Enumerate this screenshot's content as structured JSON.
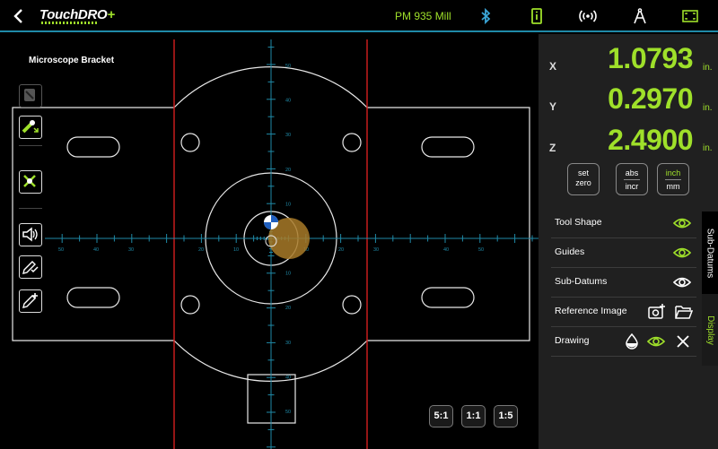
{
  "app": {
    "logo_main": "TouchDRO",
    "logo_plus": "+",
    "machine_name": "PM 935 Mill"
  },
  "drawing": {
    "title": "Microscope Bracket",
    "ruler_labels_h": [
      "50",
      "40",
      "30",
      "20",
      "10",
      "10",
      "20",
      "30",
      "40",
      "50"
    ],
    "ruler_labels_v_top": [
      "50",
      "40",
      "30",
      "20",
      "10"
    ],
    "ruler_labels_v_bottom": [
      "10",
      "20",
      "30",
      "40",
      "50"
    ]
  },
  "readout": {
    "x_label": "X",
    "x_value": "1.0793",
    "x_unit": "in.",
    "y_label": "Y",
    "y_value": "0.2970",
    "y_unit": "in.",
    "z_label": "Z",
    "z_value": "2.4900",
    "z_unit": "in."
  },
  "controls": {
    "set_zero_l1": "set",
    "set_zero_l2": "zero",
    "abs_incr_l1": "abs",
    "abs_incr_l2": "incr",
    "inch_mm_l1": "inch",
    "inch_mm_l2": "mm"
  },
  "options": {
    "tool_shape": "Tool Shape",
    "guides": "Guides",
    "sub_datums": "Sub-Datums",
    "reference_image": "Reference Image",
    "drawing": "Drawing"
  },
  "zoom": {
    "z5_1": "5:1",
    "z1_1": "1:1",
    "z1_5": "1:5"
  },
  "tabs": {
    "sub_datums": "Sub-Datums",
    "display": "Display"
  },
  "colors": {
    "accent_green": "#9fe02a",
    "axis_cyan": "#1f8aa8",
    "guide_red": "#d41e1e",
    "tool_orange": "#a87a28",
    "panel_bg": "#202020"
  },
  "icons": {
    "back": "chevron-left-icon",
    "bluetooth": "bluetooth-icon",
    "info": "info-icon",
    "broadcast": "broadcast-icon",
    "compass": "compass-icon",
    "fullscreen": "fullscreen-icon"
  }
}
